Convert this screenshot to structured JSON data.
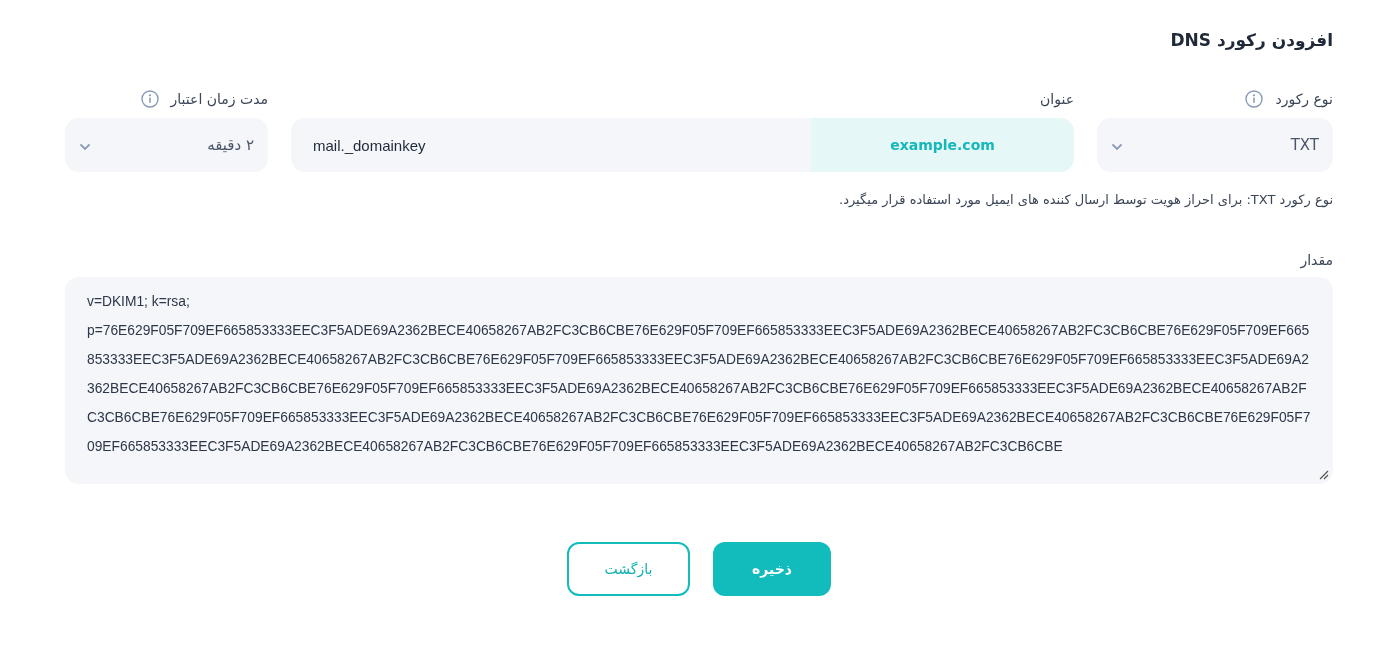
{
  "title": "افزودن رکورد DNS",
  "fields": [
    {
      "kind": "select",
      "label": "نوع رکورد",
      "info": true,
      "value": "TXT"
    },
    {
      "kind": "domain",
      "label": "عنوان",
      "value": "mail._domainkey",
      "suffix": "example.com"
    },
    {
      "kind": "select",
      "label": "مدت زمان اعتبار",
      "info": true,
      "value": "۲ دقیقه"
    }
  ],
  "hint": "نوع رکورد TXT: برای احراز هویت توسط ارسال کننده های ایمیل مورد استفاده قرار میگیرد.",
  "value_field": {
    "label": "مقدار",
    "value": "v=DKIM1; k=rsa; p=76E629F05F709EF665853333EEC3F5ADE69A2362BECE40658267AB2FC3CB6CBE76E629F05F709EF665853333EEC3F5ADE69A2362BECE40658267AB2FC3CB6CBE76E629F05F709EF665853333EEC3F5ADE69A2362BECE40658267AB2FC3CB6CBE76E629F05F709EF665853333EEC3F5ADE69A2362BECE40658267AB2FC3CB6CBE76E629F05F709EF665853333EEC3F5ADE69A2362BECE40658267AB2FC3CB6CBE76E629F05F709EF665853333EEC3F5ADE69A2362BECE40658267AB2FC3CB6CBE76E629F05F709EF665853333EEC3F5ADE69A2362BECE40658267AB2FC3CB6CBE76E629F05F709EF665853333EEC3F5ADE69A2362BECE40658267AB2FC3CB6CBE76E629F05F709EF665853333EEC3F5ADE69A2362BECE40658267AB2FC3CB6CBE76E629F05F709EF665853333EEC3F5ADE69A2362BECE40658267AB2FC3CB6CBE76E629F05F709EF665853333EEC3F5ADE69A2362BECE40658267AB2FC3CB6CBE"
  },
  "buttons": [
    {
      "kind": "primary",
      "label": "ذخیره"
    },
    {
      "kind": "secondary",
      "label": "بازگشت"
    }
  ]
}
